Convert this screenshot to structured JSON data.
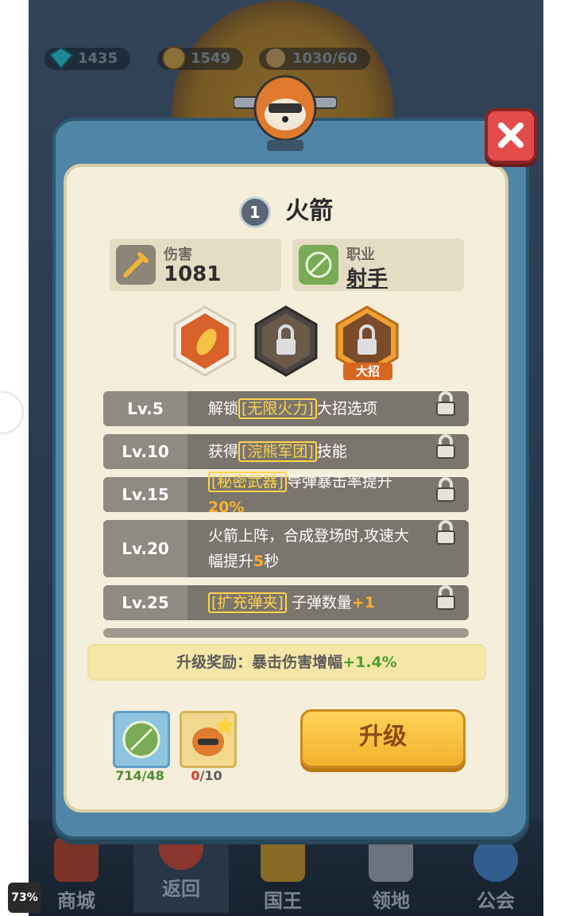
{
  "resources": {
    "gems": "1435",
    "gold": "1549",
    "stamina": "1030/60"
  },
  "hero": {
    "star": "1",
    "name": "火箭"
  },
  "stats": {
    "damage_label": "伤害",
    "damage_value": "1081",
    "class_label": "职业",
    "class_value": "射手"
  },
  "skills": {
    "ultimate_tag": "大招"
  },
  "levels": [
    {
      "lv": "Lv.5",
      "parts": [
        [
          "t",
          "解锁"
        ],
        [
          "h",
          "[无限火力]"
        ],
        [
          "t",
          "大招选项"
        ]
      ]
    },
    {
      "lv": "Lv.10",
      "parts": [
        [
          "t",
          "获得"
        ],
        [
          "h",
          "[浣熊军团]"
        ],
        [
          "t",
          "技能"
        ]
      ]
    },
    {
      "lv": "Lv.15",
      "parts": [
        [
          "h",
          "[秘密武器]"
        ],
        [
          "t",
          "导弹暴击率提升"
        ],
        [
          "n",
          "20%"
        ]
      ]
    },
    {
      "lv": "Lv.20",
      "parts": [
        [
          "t",
          "火箭上阵，合成登场时,攻速大幅提升"
        ],
        [
          "n",
          "5"
        ],
        [
          "t",
          "秒"
        ]
      ]
    },
    {
      "lv": "Lv.25",
      "parts": [
        [
          "h",
          "[扩充弹夹]"
        ],
        [
          "t",
          " 子弹数量"
        ],
        [
          "n",
          "+1"
        ]
      ]
    }
  ],
  "reward": {
    "label": "升级奖励：暴击伤害增幅",
    "value": "+1.4%"
  },
  "materials": {
    "class_material_count": "714/48",
    "shard_count": "0/10"
  },
  "upgrade_label": "升级",
  "nav": {
    "shop": "商城",
    "back": "返回",
    "king": "国王",
    "territory": "领地",
    "guild": "公会"
  },
  "battery": "73%",
  "colors": {
    "accent_gold": "#f3b02c",
    "panel": "#f5eedb",
    "frame_blue": "#4f86a8",
    "close_red": "#e24c4c"
  }
}
